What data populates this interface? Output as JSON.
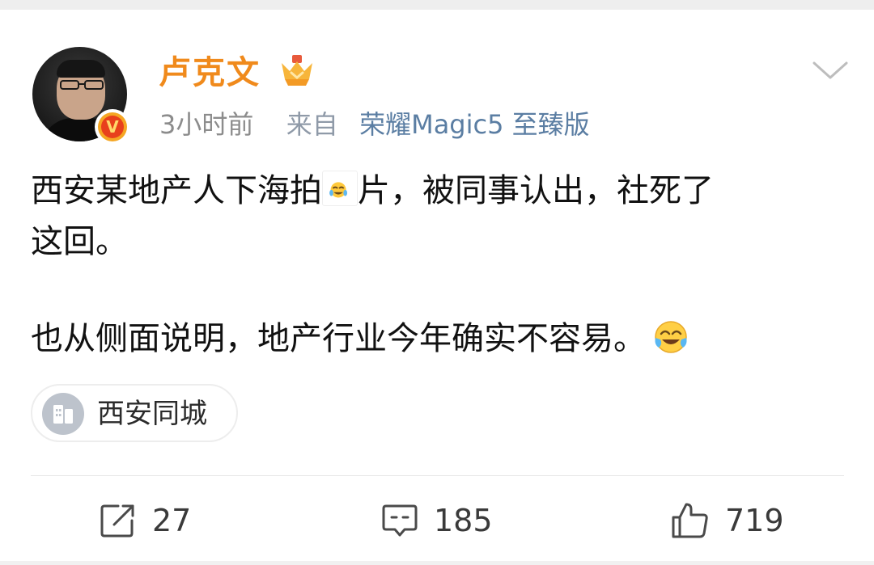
{
  "post": {
    "author": {
      "name": "卢克文",
      "verified_badge": "v-badge-icon",
      "member_badge": "crown-icon"
    },
    "meta": {
      "time": "3小时前",
      "source_prefix": "来自",
      "device": "荣耀Magic5 至臻版"
    },
    "text": {
      "line1_before": "西安某地产人下海拍",
      "line1_emoji": "laugh-cry-emoji",
      "line1_after": "片，被同事认出，社死了",
      "line2": "这回。",
      "line3": "也从侧面说明，地产行业今年确实不容易。",
      "line3_emoji": "laugh-cry-emoji"
    },
    "location": {
      "icon": "building-icon",
      "label": "西安同城"
    },
    "actions": {
      "repost": {
        "icon": "share-icon",
        "count": "27"
      },
      "comment": {
        "icon": "comment-icon",
        "count": "185"
      },
      "like": {
        "icon": "thumbs-up-icon",
        "count": "719"
      }
    }
  },
  "colors": {
    "username": "#f08a1c",
    "device_link": "#5b7ea3",
    "meta_gray": "#8c8c8c",
    "text": "#111111"
  }
}
